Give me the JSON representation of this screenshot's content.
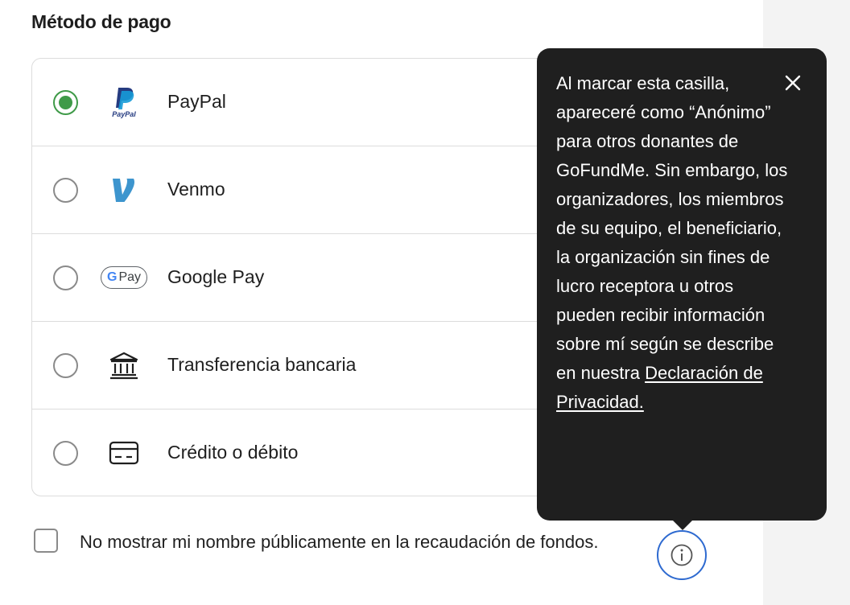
{
  "section_title": "Método de pago",
  "payment_methods": [
    {
      "label": "PayPal",
      "icon": "paypal-logo",
      "selected": true,
      "logo_text": "PayPal"
    },
    {
      "label": "Venmo",
      "icon": "venmo-logo",
      "selected": false
    },
    {
      "label": "Google Pay",
      "icon": "google-pay-logo",
      "selected": false,
      "logo_text": "Pay"
    },
    {
      "label": "Transferencia bancaria",
      "icon": "bank-icon",
      "selected": false
    },
    {
      "label": "Crédito o débito",
      "icon": "credit-card-icon",
      "selected": false
    }
  ],
  "anonymous": {
    "label": "No mostrar mi nombre públicamente en la recaudación de fondos.",
    "checked": false
  },
  "tooltip": {
    "text": "Al marcar esta casilla, apareceré como “Anónimo” para otros donantes de GoFundMe. Sin embargo, los organizadores, los miembros de su equipo, el beneficiario, la organización sin fines de lucro receptora u otros pueden recibir información sobre mí según se describe en nuestra ",
    "link": "Declaración de Privacidad."
  },
  "colors": {
    "selected_radio": "#3f9a48",
    "tooltip_bg": "#1f1f1f",
    "info_button_border": "#2e6ad0",
    "venmo_blue": "#3d95ce",
    "paypal_dark": "#253b80",
    "paypal_light": "#179bd7"
  }
}
